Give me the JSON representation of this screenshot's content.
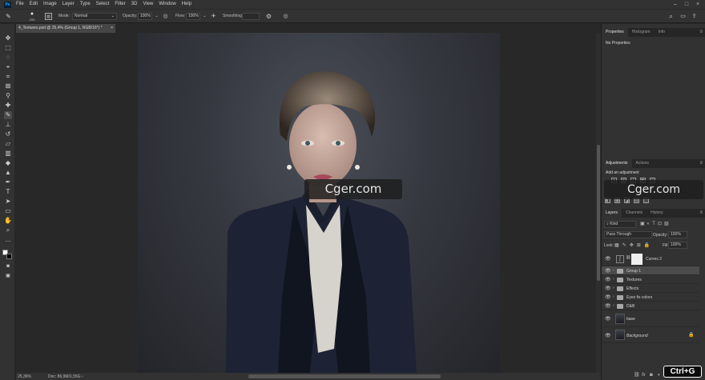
{
  "menu": [
    "File",
    "Edit",
    "Image",
    "Layer",
    "Type",
    "Select",
    "Filter",
    "3D",
    "View",
    "Window",
    "Help"
  ],
  "app_logo": "Ps",
  "options": {
    "brush_size": "290",
    "mode_label": "Mode:",
    "mode_value": "Normal",
    "opacity_label": "Opacity:",
    "opacity_value": "100%",
    "flow_label": "Flow:",
    "flow_value": "100%",
    "smoothing_label": "Smoothing:"
  },
  "document_tab": "4_Textures.psd @ 25,4% (Group 1, RGB/16*) *",
  "status": {
    "zoom": "25,36%",
    "doc": "Doc: 86,9M/1,55G"
  },
  "panels": {
    "top_tabs": [
      "Properties",
      "Histogram",
      "Info"
    ],
    "properties_text": "No Properties",
    "adj_tabs": [
      "Adjustments",
      "Actions"
    ],
    "adj_title": "Add an adjustment",
    "layer_tabs": [
      "Layers",
      "Channels",
      "History"
    ],
    "kind_label": "Kind",
    "blend_mode": "Pass Through",
    "opacity_label": "Opacity:",
    "opacity_value": "100%",
    "lock_label": "Lock:",
    "fill_label": "Fill:",
    "fill_value": "100%"
  },
  "layers": [
    {
      "name": "Curves 2",
      "type": "adjustment",
      "selected": false
    },
    {
      "name": "Group 1",
      "type": "group",
      "selected": true
    },
    {
      "name": "Textures",
      "type": "group",
      "selected": false
    },
    {
      "name": "Effects",
      "type": "group",
      "selected": false
    },
    {
      "name": "Eyes fix colors",
      "type": "group",
      "selected": false
    },
    {
      "name": "D&B",
      "type": "group",
      "selected": false
    },
    {
      "name": "base",
      "type": "pixel",
      "selected": false
    },
    {
      "name": "Background",
      "type": "pixel",
      "selected": false
    }
  ],
  "watermark": "Cger.com",
  "shortcut_badge": "Ctrl+G",
  "colors": {
    "accent": "#31a8ff",
    "ui_dark": "#323232",
    "canvas_bg": "#282828"
  }
}
